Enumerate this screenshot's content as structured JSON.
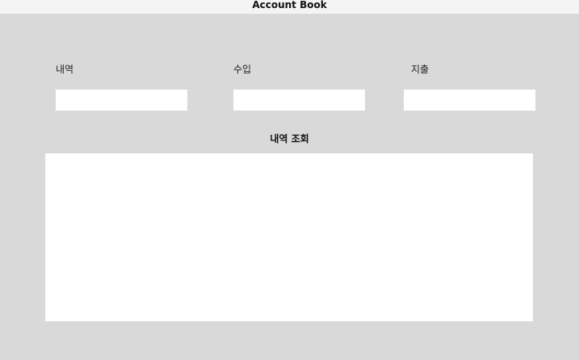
{
  "window": {
    "title": "Account Book"
  },
  "form": {
    "description_label": "내역",
    "description_value": "",
    "income_label": "수입",
    "income_value": "",
    "expense_label": "지출",
    "expense_value": ""
  },
  "history": {
    "title": "내역 조회",
    "content": ""
  }
}
